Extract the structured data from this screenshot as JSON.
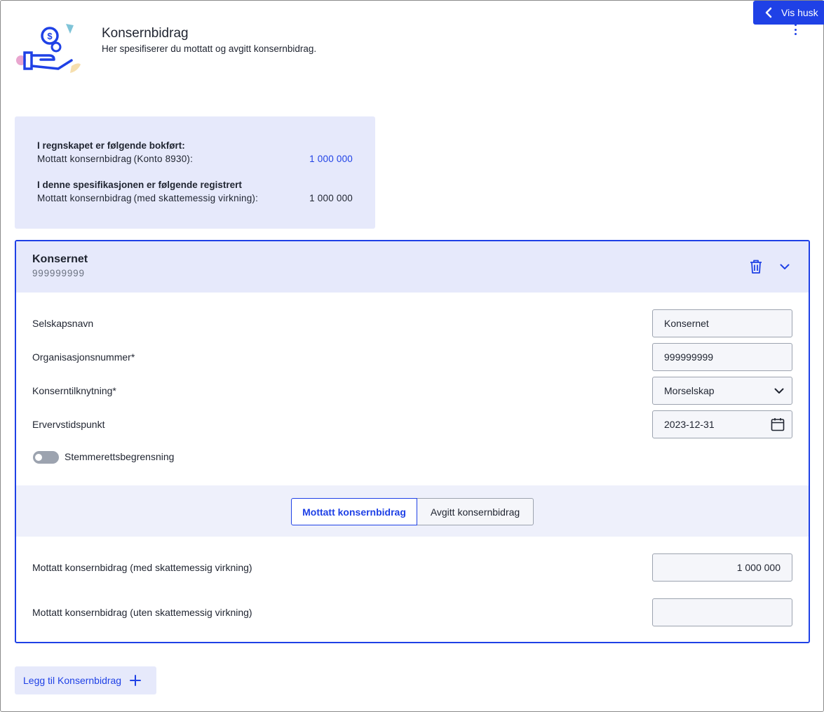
{
  "header": {
    "title": "Konsernbidrag",
    "subtitle": "Her spesifiserer du mottatt og avgitt konsernbidrag."
  },
  "topbar": {
    "vis_button_label": "Vis husk"
  },
  "summary": {
    "booked_heading": "I regnskapet er følgende bokført:",
    "booked_label": "Mottatt konsernbidrag (Konto 8930):",
    "booked_value": "1 000 000",
    "registered_heading": "I denne spesifikasjonen er følgende registrert",
    "registered_label": "Mottatt konsernbidrag (med skattemessig virkning):",
    "registered_value": "1 000 000"
  },
  "company": {
    "name": "Konsernet",
    "org_number": "999999999",
    "fields": {
      "company_name_label": "Selskapsnavn",
      "company_name_value": "Konsernet",
      "org_label": "Organisasjonsnummer*",
      "org_value": "999999999",
      "relation_label": "Konserntilknytning*",
      "relation_value": "Morselskap",
      "acquired_label": "Ervervstidspunkt",
      "acquired_value": "2023-12-31",
      "voting_toggle_label": "Stemmerettsbegrensning"
    },
    "tabs": [
      {
        "label": "Mottatt konsernbidrag",
        "active": true
      },
      {
        "label": "Avgitt konsernbidrag",
        "active": false
      }
    ],
    "amounts": {
      "with_tax_label": "Mottatt konsernbidrag (med skattemessig virkning)",
      "with_tax_value": "1 000 000",
      "without_tax_label": "Mottatt konsernbidrag (uten skattemessig virkning)",
      "without_tax_value": ""
    }
  },
  "footer": {
    "add_button_label": "Legg til Konsernbidrag"
  },
  "colors": {
    "accent": "#1f41e6",
    "summary_bg": "#e6e9fb",
    "field_bg": "#f5f6fa"
  }
}
